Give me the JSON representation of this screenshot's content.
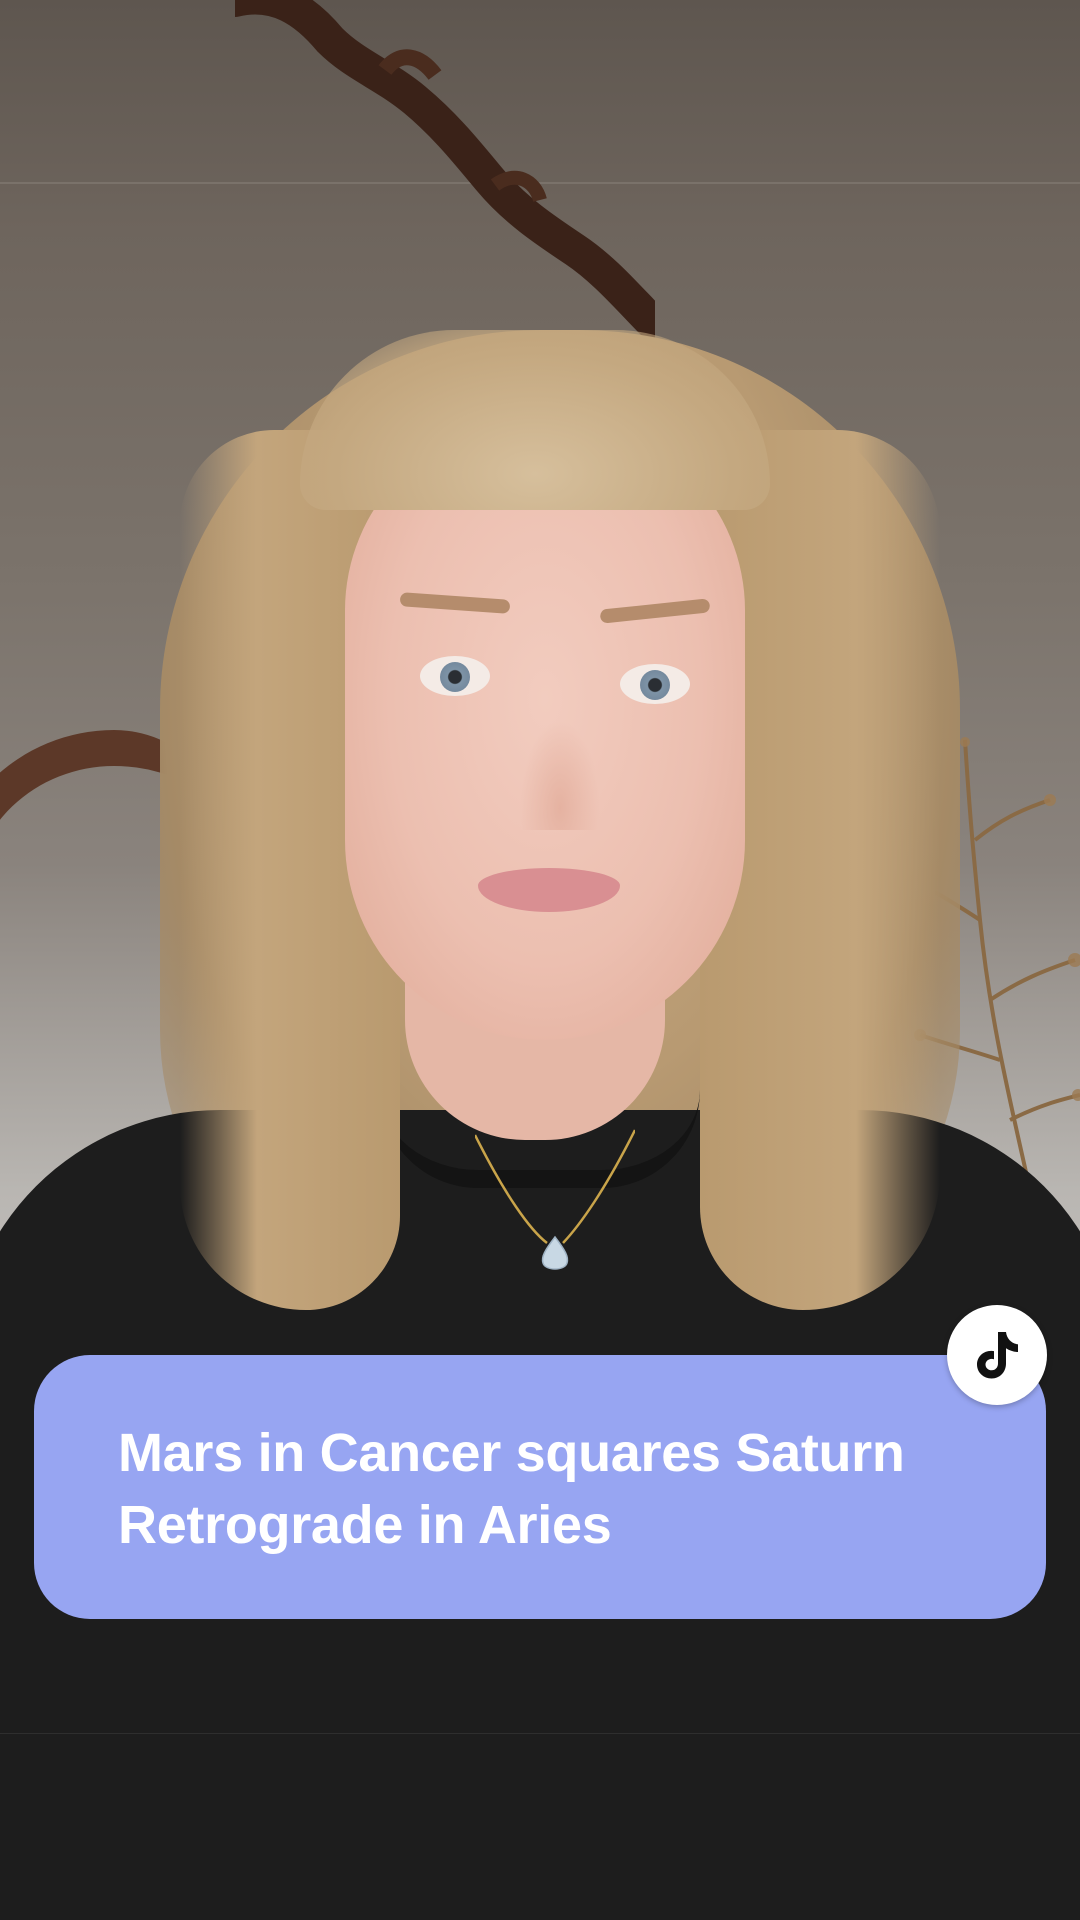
{
  "screen": {
    "type": "short-video-frame",
    "background": "person speaking in front of a wall with ornate mirror frame and dried plant"
  },
  "caption": {
    "text": "Mars in Cancer squares Saturn Retrograde in Aries",
    "background_color": "#97a5f2",
    "text_color": "#ffffff"
  },
  "badge": {
    "icon": "tiktok-logo-icon",
    "background_color": "#ffffff"
  }
}
